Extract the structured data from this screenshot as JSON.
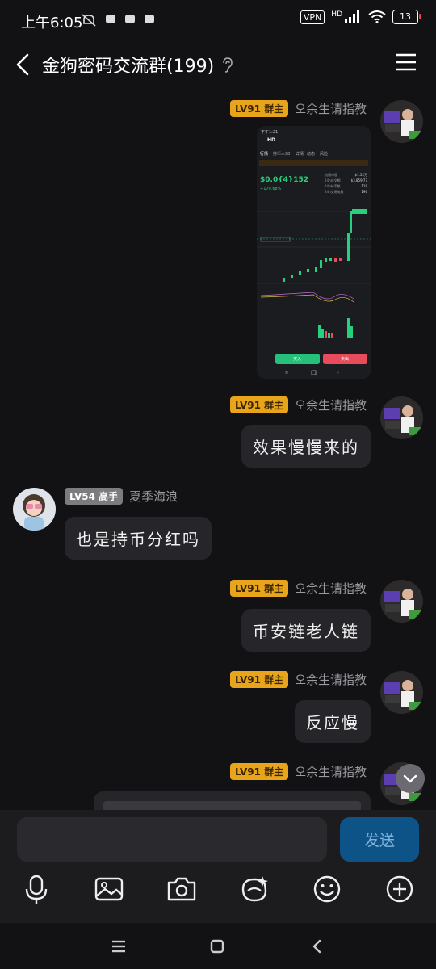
{
  "status_bar": {
    "time": "上午6:05",
    "vpn": "VPN",
    "network": "HD",
    "battery": "13"
  },
  "header": {
    "title": "金狗密码交流群(199)"
  },
  "messages": [
    {
      "sender": "오余生请指教",
      "badge": "LV91 群主",
      "type": "image"
    },
    {
      "sender": "오余生请指教",
      "badge": "LV91 群主",
      "text": "效果慢慢来的"
    },
    {
      "sender": "夏季海浪",
      "badge": "LV54 高手",
      "text": "也是持币分红吗"
    },
    {
      "sender": "오余生请指教",
      "badge": "LV91 群主",
      "text": "币安链老人链"
    },
    {
      "sender": "오余生请指教",
      "badge": "LV91 群主",
      "text": "反应慢"
    },
    {
      "sender": "오余生请指教",
      "badge": "LV91 群主",
      "type": "partial"
    }
  ],
  "shared_screenshot": {
    "time": "下午1:21",
    "token": "HD",
    "tabs": [
      "行情",
      "持币人98",
      "详情",
      "动态",
      "风险"
    ],
    "price": "$0.0{4}152",
    "change": "+170.68%",
    "stats": [
      {
        "label": "流通市值",
        "value": "$1.52万"
      },
      {
        "label": "24h成交额",
        "value": "$3,859.77"
      },
      {
        "label": "24h持币数",
        "value": "119"
      },
      {
        "label": "24h交易笔数",
        "value": "196"
      }
    ],
    "buy_label": "买入",
    "sell_label": "卖出"
  },
  "input": {
    "placeholder": "",
    "send_label": "发送"
  },
  "colors": {
    "owner_badge": "#e8a51c",
    "send_button": "#0e5388",
    "bubble": "#26262a",
    "background": "#121214"
  }
}
